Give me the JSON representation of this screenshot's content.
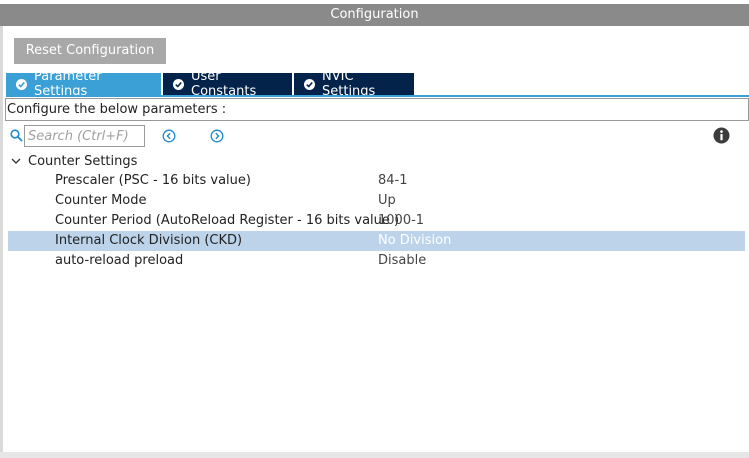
{
  "window": {
    "title": "Configuration"
  },
  "toolbar": {
    "reset_label": "Reset Configuration"
  },
  "tabs": [
    {
      "label": "Parameter Settings",
      "active": true
    },
    {
      "label": "User Constants",
      "active": false
    },
    {
      "label": "NVIC Settings",
      "active": false
    }
  ],
  "panel": {
    "configure_text": "Configure the below parameters :",
    "search_placeholder": "Search (Ctrl+F)"
  },
  "group": {
    "label": "Counter Settings",
    "expanded": true,
    "params": [
      {
        "name": "Prescaler (PSC - 16 bits value)",
        "value": "84-1"
      },
      {
        "name": "Counter Mode",
        "value": "Up"
      },
      {
        "name": "Counter Period (AutoReload Register - 16 bits value )",
        "value": "1000-1"
      },
      {
        "name": "Internal Clock Division (CKD)",
        "value": "No Division",
        "selected": true
      },
      {
        "name": "auto-reload preload",
        "value": "Disable"
      }
    ]
  },
  "icons": {
    "check": "check-circle-icon",
    "search": "search-icon",
    "prev": "chevron-left-circle-icon",
    "next": "chevron-right-circle-icon",
    "info": "info-icon",
    "expand": "chevron-down-icon"
  },
  "colors": {
    "title_bar": "#8a8a8a",
    "tab_active": "#3aa0d6",
    "tab_inactive": "#03234b",
    "selected_row": "#bcd3ea",
    "accent": "#3aa0d6"
  }
}
